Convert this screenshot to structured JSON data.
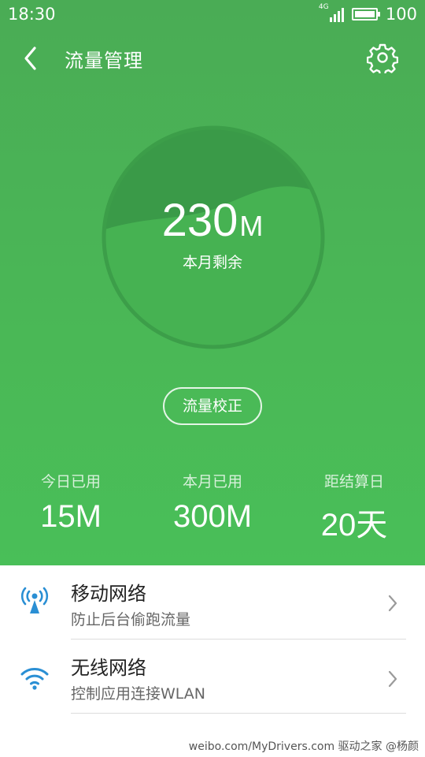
{
  "status_bar": {
    "time": "18:30",
    "network": "4G",
    "battery": "100"
  },
  "header": {
    "title": "流量管理",
    "back_icon": "back-arrow-icon",
    "settings_icon": "gear-icon"
  },
  "gauge": {
    "remaining_value": "230",
    "remaining_unit": "M",
    "remaining_label": "本月剩余",
    "fill_level": 0.62
  },
  "calibrate_button": {
    "label": "流量校正"
  },
  "stats": [
    {
      "label": "今日已用",
      "value": "15M"
    },
    {
      "label": "本月已用",
      "value": "300M"
    },
    {
      "label": "距结算日",
      "value": "20天"
    }
  ],
  "list": [
    {
      "title": "移动网络",
      "subtitle": "防止后台偷跑流量",
      "icon": "cell-tower-icon"
    },
    {
      "title": "无线网络",
      "subtitle": "控制应用连接WLAN",
      "icon": "wifi-icon"
    }
  ],
  "watermark": "weibo.com/MyDrivers.com 驱动之家 @杨颜",
  "colors": {
    "primary_green": "#4ab756",
    "dark_green": "#3a9a48",
    "icon_blue": "#2a8fd4"
  }
}
